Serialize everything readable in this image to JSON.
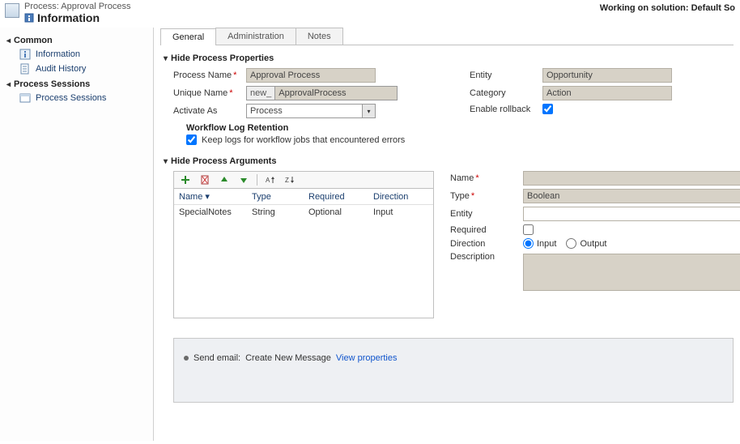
{
  "header": {
    "typeLabel": "Process: Approval Process",
    "title": "Information",
    "workingOn": "Working on solution: Default So"
  },
  "sidebar": {
    "groups": [
      {
        "title": "Common",
        "items": [
          {
            "label": "Information",
            "icon": "info-icon"
          },
          {
            "label": "Audit History",
            "icon": "audit-icon"
          }
        ]
      },
      {
        "title": "Process Sessions",
        "items": [
          {
            "label": "Process Sessions",
            "icon": "sessions-icon"
          }
        ]
      }
    ]
  },
  "tabs": [
    "General",
    "Administration",
    "Notes"
  ],
  "activeTab": 0,
  "properties": {
    "sectionTitle": "Hide Process Properties",
    "processNameLabel": "Process Name",
    "processName": "Approval Process",
    "uniqueNameLabel": "Unique Name",
    "uniqueNamePrefix": "new_",
    "uniqueName": "ApprovalProcess",
    "activateAsLabel": "Activate As",
    "activateAs": "Process",
    "entityLabel": "Entity",
    "entity": "Opportunity",
    "categoryLabel": "Category",
    "category": "Action",
    "enableRollbackLabel": "Enable rollback",
    "enableRollback": true,
    "logTitle": "Workflow Log Retention",
    "keepLogsLabel": "Keep logs for workflow jobs that encountered errors",
    "keepLogs": true
  },
  "arguments": {
    "sectionTitle": "Hide Process Arguments",
    "columns": [
      "Name",
      "Type",
      "Required",
      "Direction"
    ],
    "rows": [
      {
        "name": "SpecialNotes",
        "type": "String",
        "required": "Optional",
        "direction": "Input"
      }
    ],
    "detail": {
      "nameLabel": "Name",
      "name": "",
      "typeLabel": "Type",
      "type": "Boolean",
      "entityLabel": "Entity",
      "entity": "",
      "requiredLabel": "Required",
      "required": false,
      "directionLabel": "Direction",
      "directionInput": "Input",
      "directionOutput": "Output",
      "directionValue": "Input",
      "descriptionLabel": "Description"
    }
  },
  "steps": {
    "label": "Send email:",
    "stepName": "Create New Message",
    "viewLink": "View properties"
  }
}
